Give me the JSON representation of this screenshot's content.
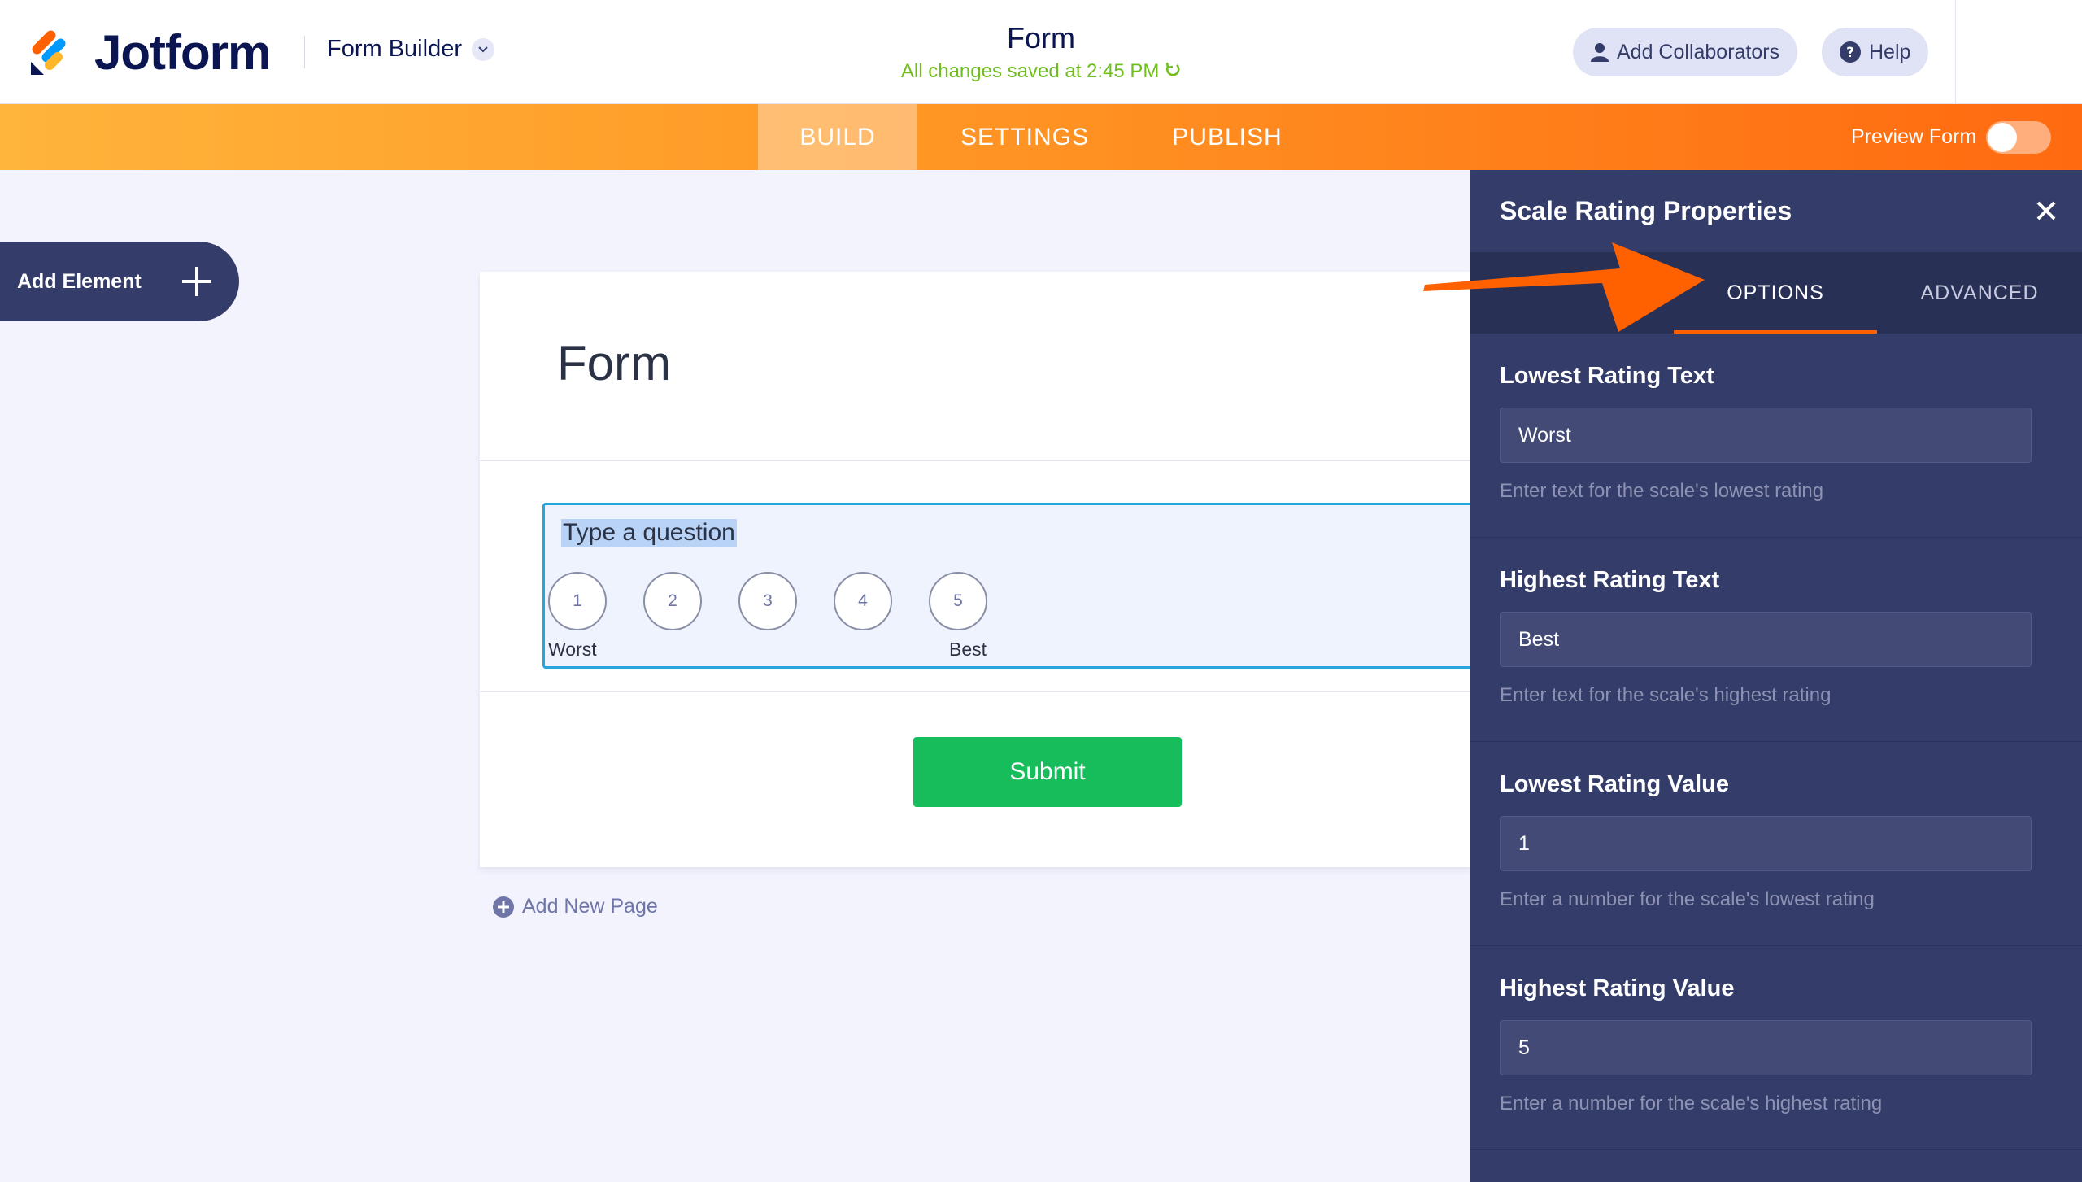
{
  "header": {
    "logo_text": "Jotform",
    "builder_label": "Form Builder",
    "title": "Form",
    "saved_status": "All changes saved at 2:45 PM",
    "collaborators_label": "Add Collaborators",
    "help_label": "Help"
  },
  "navbar": {
    "tabs": [
      {
        "label": "BUILD",
        "active": true
      },
      {
        "label": "SETTINGS",
        "active": false
      },
      {
        "label": "PUBLISH",
        "active": false
      }
    ],
    "preview_label": "Preview Form",
    "preview_on": false
  },
  "sidebar": {
    "add_element_label": "Add Element"
  },
  "form": {
    "title": "Form",
    "question_label": "Type a question",
    "scale": [
      "1",
      "2",
      "3",
      "4",
      "5"
    ],
    "lowest_text": "Worst",
    "highest_text": "Best",
    "submit_label": "Submit",
    "add_page_label": "Add New Page"
  },
  "panel": {
    "title": "Scale Rating Properties",
    "tabs": [
      {
        "label": "OPTIONS",
        "active": true
      },
      {
        "label": "ADVANCED",
        "active": false
      }
    ],
    "fields": [
      {
        "label": "Lowest Rating Text",
        "value": "Worst",
        "hint": "Enter text for the scale's lowest rating"
      },
      {
        "label": "Highest Rating Text",
        "value": "Best",
        "hint": "Enter text for the scale's highest rating"
      },
      {
        "label": "Lowest Rating Value",
        "value": "1",
        "hint": "Enter a number for the scale's lowest rating"
      },
      {
        "label": "Highest Rating Value",
        "value": "5",
        "hint": "Enter a number for the scale's highest rating"
      }
    ]
  },
  "colors": {
    "brand_navy": "#0a1551",
    "accent_orange": "#ff6100",
    "saved_green": "#6fbe1e",
    "submit_green": "#18bd5b",
    "panel_bg": "#343c6a",
    "selected_border": "#2aa4de"
  }
}
